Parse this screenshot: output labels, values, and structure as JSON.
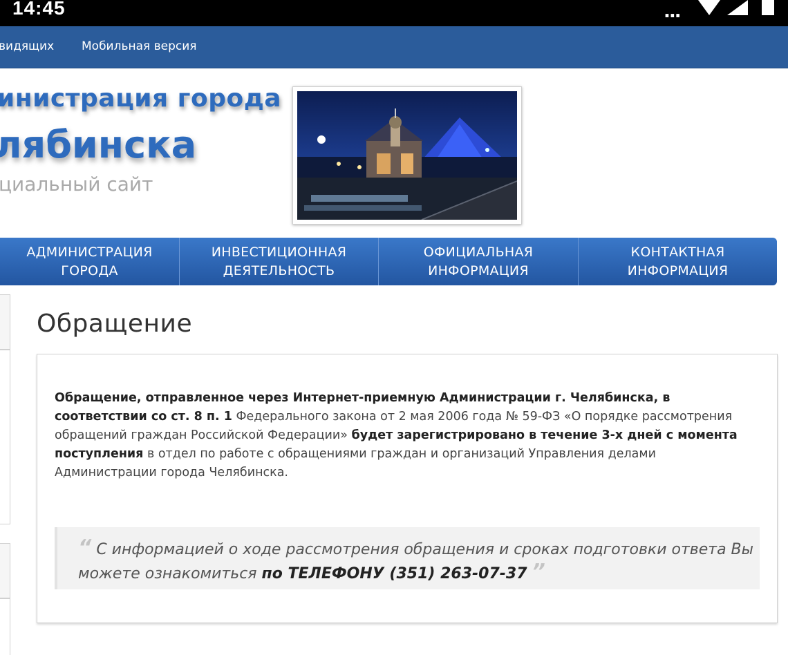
{
  "status_bar": {
    "time": "14:45",
    "dots": "..."
  },
  "top_links": [
    "видящих",
    "Мобильная версия"
  ],
  "header": {
    "title_line1": "инистрация города",
    "title_line2": "лябинска",
    "subtitle": "циальный сайт"
  },
  "main_nav": [
    {
      "line1": "АДМИНИСТРАЦИЯ",
      "line2": "ГОРОДА"
    },
    {
      "line1": "ИНВЕСТИЦИОННАЯ",
      "line2": "ДЕЯТЕЛЬНОСТЬ"
    },
    {
      "line1": "ОФИЦИАЛЬНАЯ",
      "line2": "ИНФОРМАЦИЯ"
    },
    {
      "line1": "КОНТАКТНАЯ",
      "line2": "ИНФОРМАЦИЯ"
    }
  ],
  "page_title": "Обращение",
  "paragraph": {
    "bold1": "Обращение, отправленное через Интернет-приемную Администрации г. Челябинска, в соответствии со ст. 8 п. 1",
    "normal1": " Федерального закона от 2 мая 2006 года № 59-ФЗ «О порядке рассмотрения обращений граждан Российской Федерации» ",
    "bold2": "будет зарегистрировано в течение 3-х дней с момента поступления",
    "normal2": " в отдел по работе с обращениями граждан и организаций Управления делами Администрации города Челябинска."
  },
  "quote": {
    "open_mark": "“",
    "text": "С информацией о ходе рассмотрения обращения и сроках подготовки ответа Вы можете ознакомиться ",
    "bold": "по ТЕЛЕФОНУ (351) 263-07-37",
    "close_mark": "”"
  },
  "colors": {
    "top_bar": "#2b5c9b",
    "nav_bar": "#2e68b4",
    "title_blue": "#2e6bbd",
    "subtitle_gray": "#a9a9a9"
  }
}
